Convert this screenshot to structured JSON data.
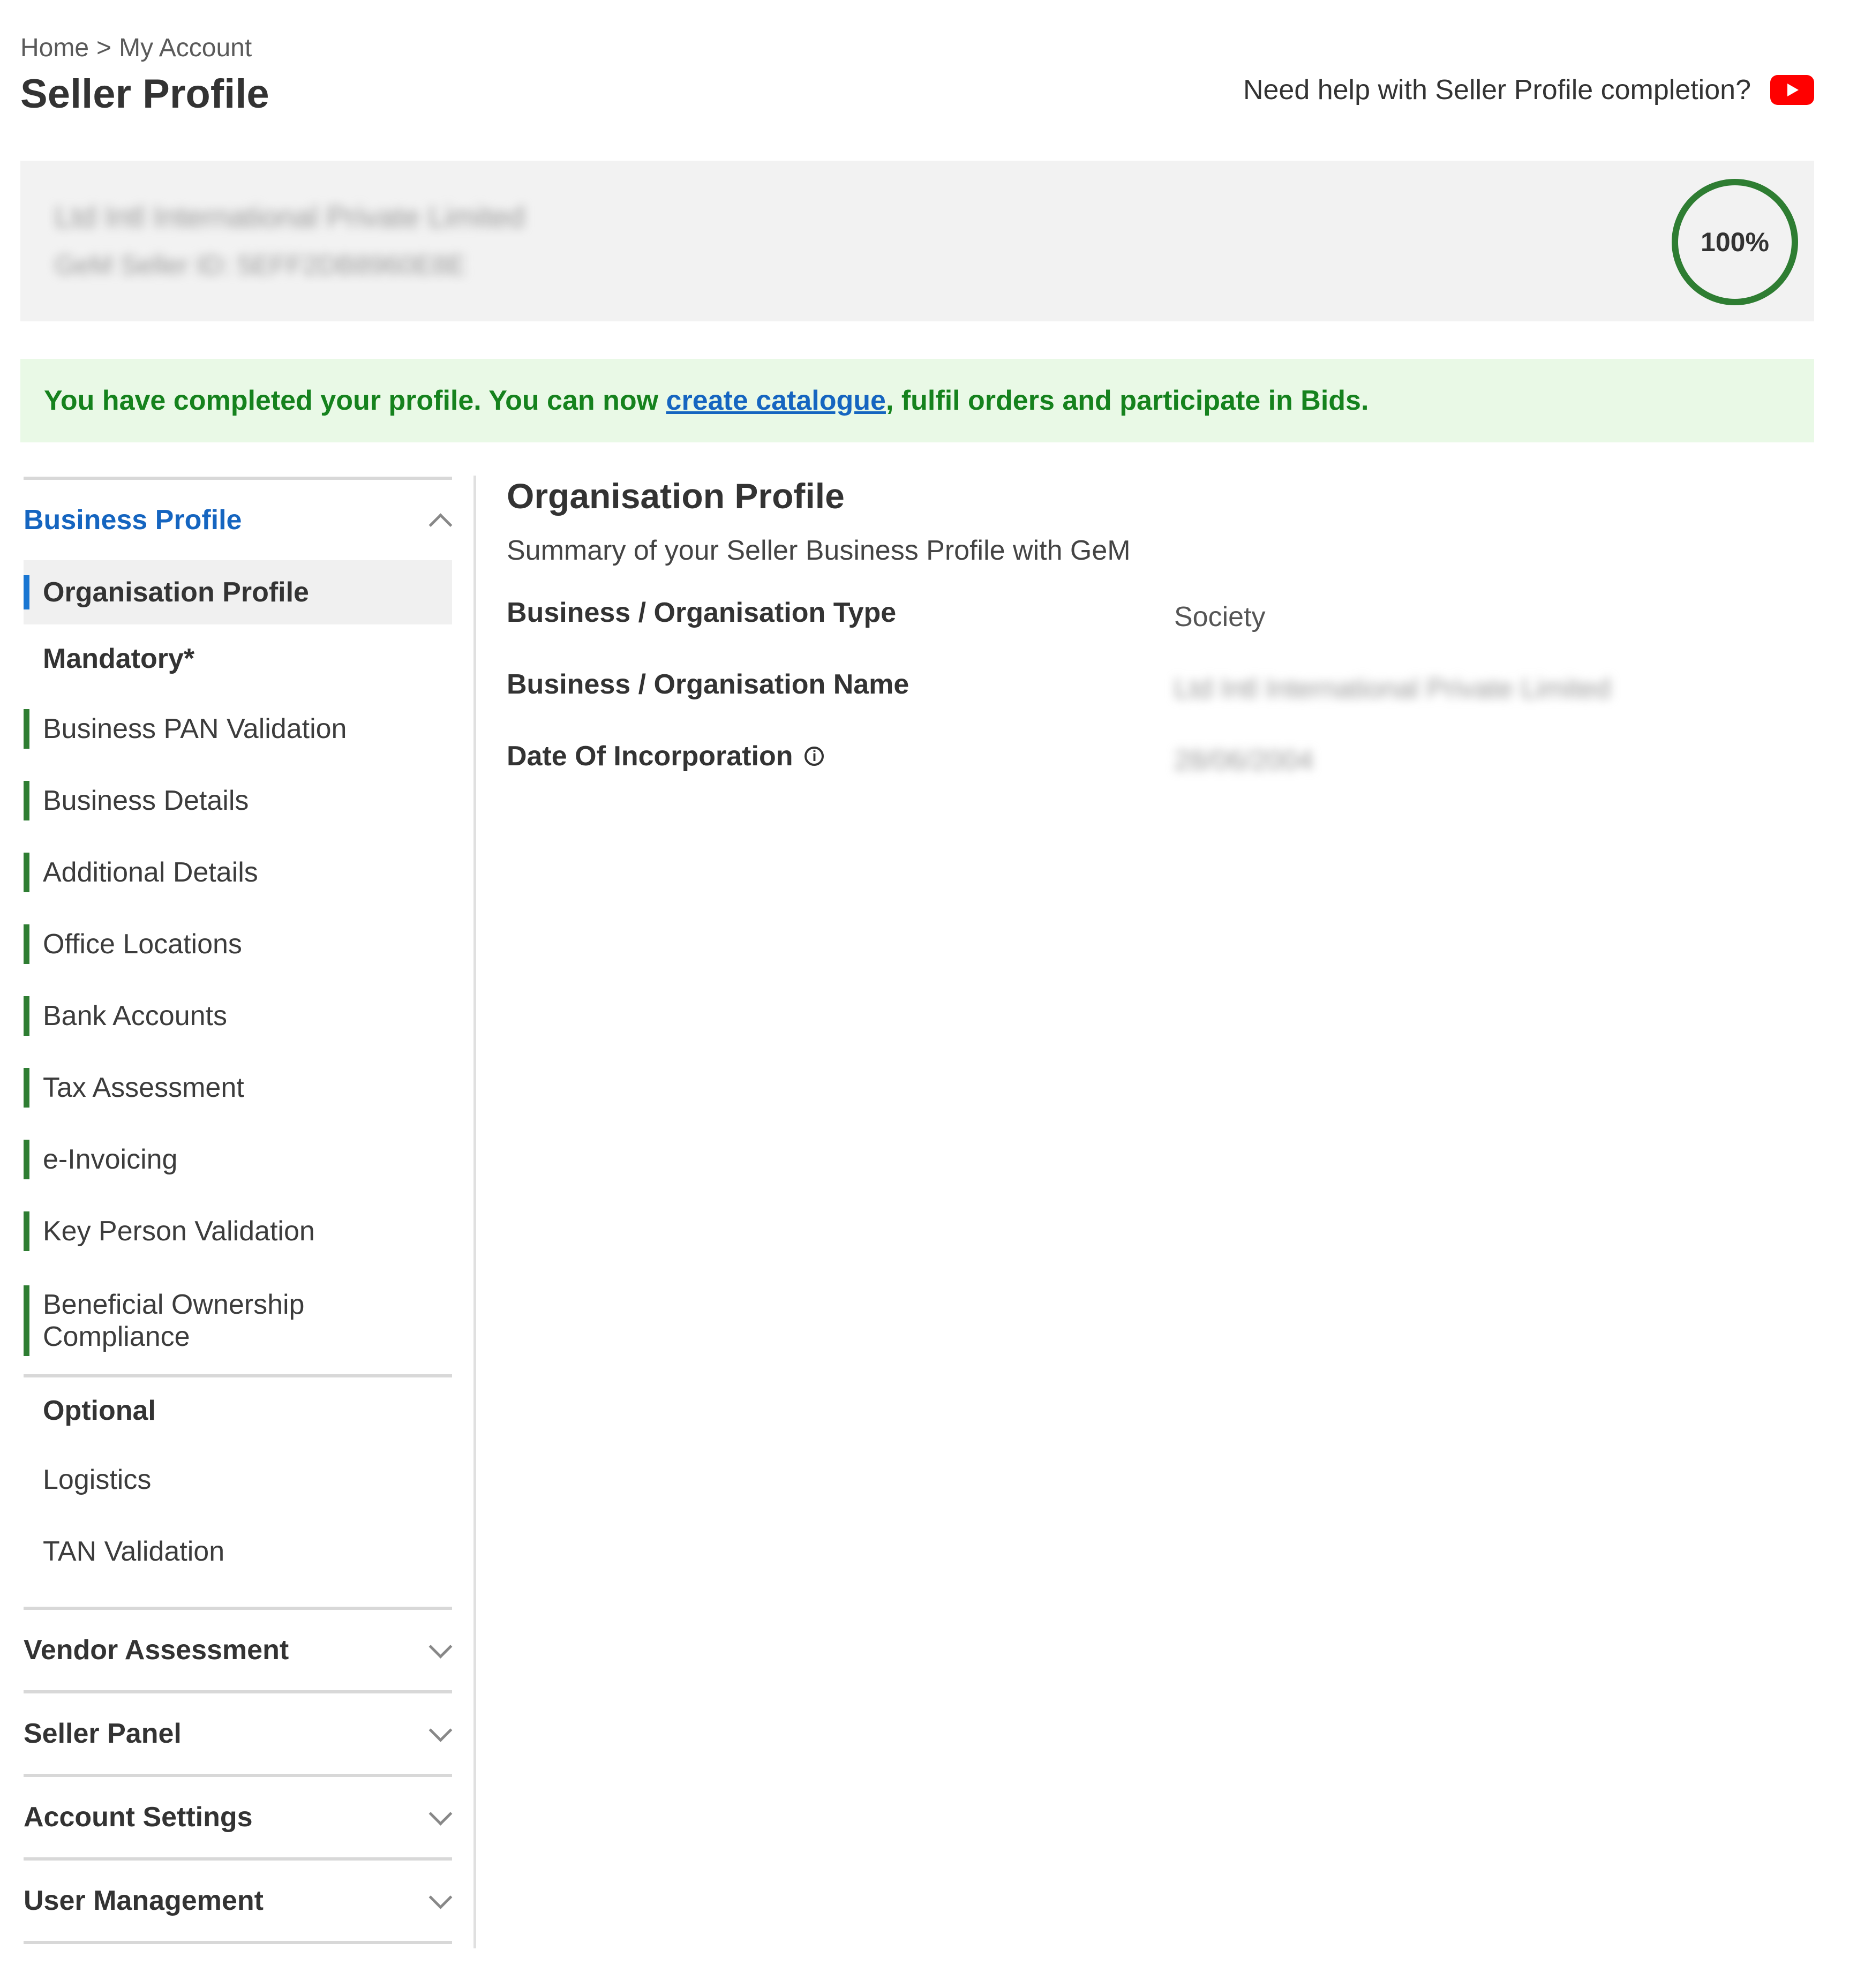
{
  "breadcrumb": {
    "home": "Home",
    "separator": ">",
    "current": "My Account"
  },
  "page_title": "Seller Profile",
  "help": {
    "text": "Need help with Seller Profile completion?",
    "icon": "youtube-play-icon"
  },
  "profile_summary": {
    "company_name": "Ltd Intl International Private Limited",
    "user_id": "GeM Seller ID: 5EFF2DB8960E8E"
  },
  "completion": {
    "percent_label": "100%",
    "percent": 100
  },
  "banner": {
    "text_before": "You have completed your profile. You can now ",
    "link": "create catalogue",
    "text_after": ", fulfil orders and participate in Bids.",
    "color": "#15821d"
  },
  "sidebar": {
    "business_profile": {
      "label": "Business Profile",
      "expanded": true
    },
    "active_item": "Organisation Profile",
    "mandatory_label": "Mandatory*",
    "mandatory_items": [
      "Business PAN Validation",
      "Business Details",
      "Additional Details",
      "Office Locations",
      "Bank Accounts",
      "Tax Assessment",
      "e-Invoicing",
      "Key Person Validation",
      "Beneficial Ownership Compliance"
    ],
    "optional_label": "Optional",
    "optional_items": [
      "Logistics",
      "TAN Validation"
    ],
    "sections": [
      "Vendor Assessment",
      "Seller Panel",
      "Account Settings",
      "User Management"
    ]
  },
  "content": {
    "title": "Organisation Profile",
    "subtitle": "Summary of your Seller Business Profile with GeM",
    "fields": [
      {
        "label": "Business / Organisation Type",
        "value": "Society"
      },
      {
        "label": "Business / Organisation Name",
        "value": "Ltd Intl International Private Limited"
      },
      {
        "label": "Date Of Incorporation",
        "value": "28/06/2004"
      }
    ]
  },
  "colors": {
    "accent_blue": "#1565c0",
    "complete_green": "#2e7d32",
    "banner_bg": "#e9f9e6"
  }
}
